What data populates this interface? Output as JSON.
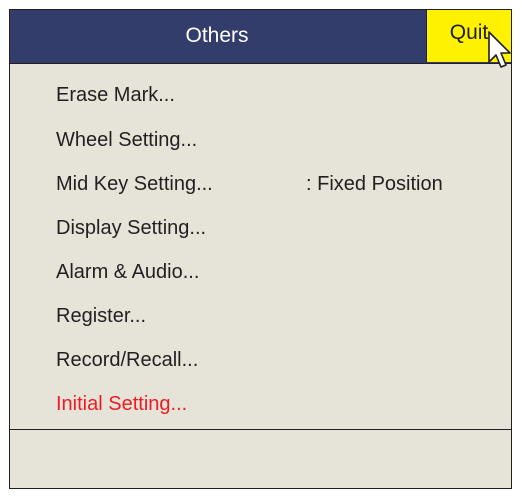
{
  "window": {
    "title": "Others",
    "quit_label": "Quit"
  },
  "menu": {
    "items": [
      {
        "label": "Erase Mark..."
      },
      {
        "label": "Wheel Setting..."
      },
      {
        "label": "Mid Key Setting...",
        "value": ": Fixed Position"
      },
      {
        "label": "Display Setting..."
      },
      {
        "label": "Alarm & Audio..."
      },
      {
        "label": "Register..."
      },
      {
        "label": "Record/Recall..."
      },
      {
        "label": "Initial Setting...",
        "color": "#ed1c24"
      }
    ]
  },
  "colors": {
    "titlebar": "#333d6b",
    "quit_highlight": "#fff200",
    "panel": "#e6e3d8",
    "warning_text": "#ed1c24"
  },
  "icons": {
    "cursor": "mouse-pointer-icon"
  }
}
